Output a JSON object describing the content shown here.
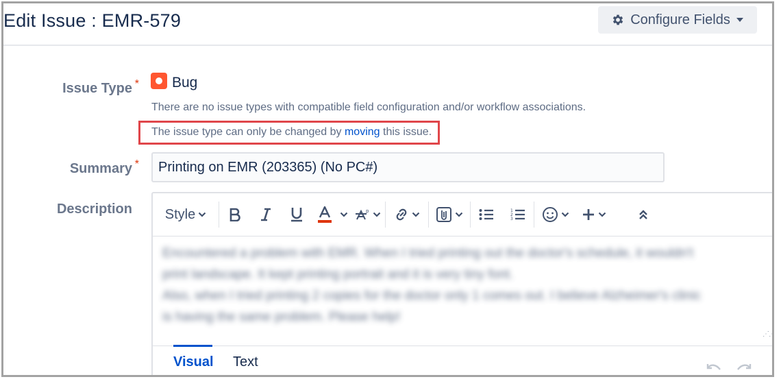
{
  "header": {
    "title": "Edit Issue : EMR-579",
    "configure_fields_label": "Configure Fields"
  },
  "fields": {
    "issue_type": {
      "label": "Issue Type",
      "required_marker": "*",
      "value": "Bug",
      "note_1": "There are no issue types with compatible field configuration and/or workflow associations.",
      "note_2_prefix": "The issue type can only be changed by ",
      "note_2_link": "moving",
      "note_2_suffix": " this issue."
    },
    "summary": {
      "label": "Summary",
      "required_marker": "*",
      "value": "Printing on EMR (203365) (No PC#)"
    },
    "description": {
      "label": "Description",
      "toolbar": {
        "style_label": "Style"
      },
      "content_lines": [
        "Encountered a problem with EMR. When I tried printing out the doctor's schedule, it wouldn't",
        "print landscape. It kept printing portrait and it is very tiny font.",
        "Also, when I tried printing 2 copies for the doctor only 1 comes out. I believe Alzheimer's clinic",
        "is having the same problem. Please help!"
      ],
      "tabs": [
        "Visual",
        "Text"
      ],
      "active_tab": "Visual"
    }
  },
  "icons": {
    "configure": "gear-icon",
    "issue_type": "bug-icon"
  },
  "colors": {
    "accent": "#0052cc",
    "required": "#de350b",
    "bug": "#ff5630",
    "highlight_box": "#e0464a"
  }
}
